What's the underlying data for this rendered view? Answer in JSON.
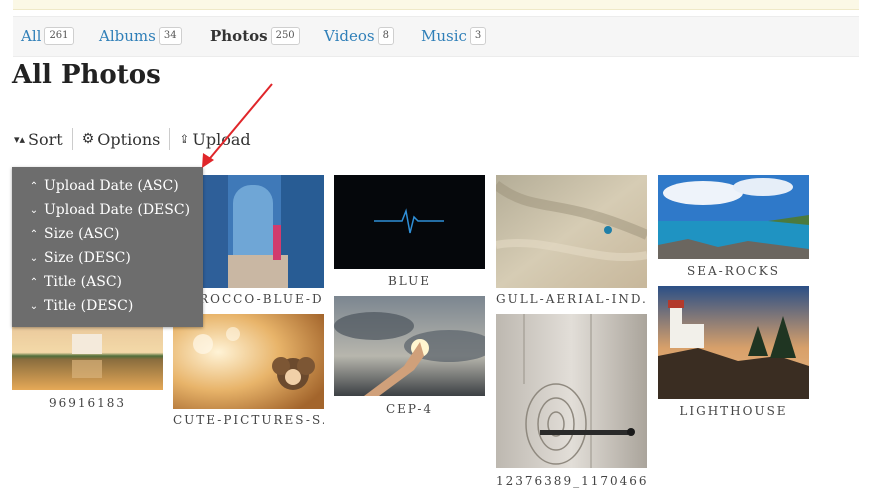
{
  "tabs": [
    {
      "label": "All",
      "count": "261"
    },
    {
      "label": "Albums",
      "count": "34"
    },
    {
      "label": "Photos",
      "count": "250"
    },
    {
      "label": "Videos",
      "count": "8"
    },
    {
      "label": "Music",
      "count": "3"
    }
  ],
  "page_title": "All Photos",
  "toolbar": {
    "sort": "Sort",
    "options": "Options",
    "upload": "Upload"
  },
  "sort_menu": [
    {
      "label": "Upload Date (ASC)",
      "dir": "up"
    },
    {
      "label": "Upload Date (DESC)",
      "dir": "down"
    },
    {
      "label": "Size (ASC)",
      "dir": "up"
    },
    {
      "label": "Size (DESC)",
      "dir": "down"
    },
    {
      "label": "Title (ASC)",
      "dir": "up"
    },
    {
      "label": "Title (DESC)",
      "dir": "down"
    }
  ],
  "photos": [
    {
      "caption": "96916183"
    },
    {
      "caption": "MOROCCO-BLUE-D..."
    },
    {
      "caption": "CUTE-PICTURES-S..."
    },
    {
      "caption": "BLUE"
    },
    {
      "caption": "CEP-4"
    },
    {
      "caption": "GULL-AERIAL-IND..."
    },
    {
      "caption": "12376389_1170466..."
    },
    {
      "caption": "SEA-ROCKS"
    },
    {
      "caption": "LIGHTHOUSE"
    }
  ],
  "colors": {
    "link": "#2f7fb8",
    "menu_bg": "#6d6d6d",
    "annotation_arrow": "#e0262a"
  }
}
